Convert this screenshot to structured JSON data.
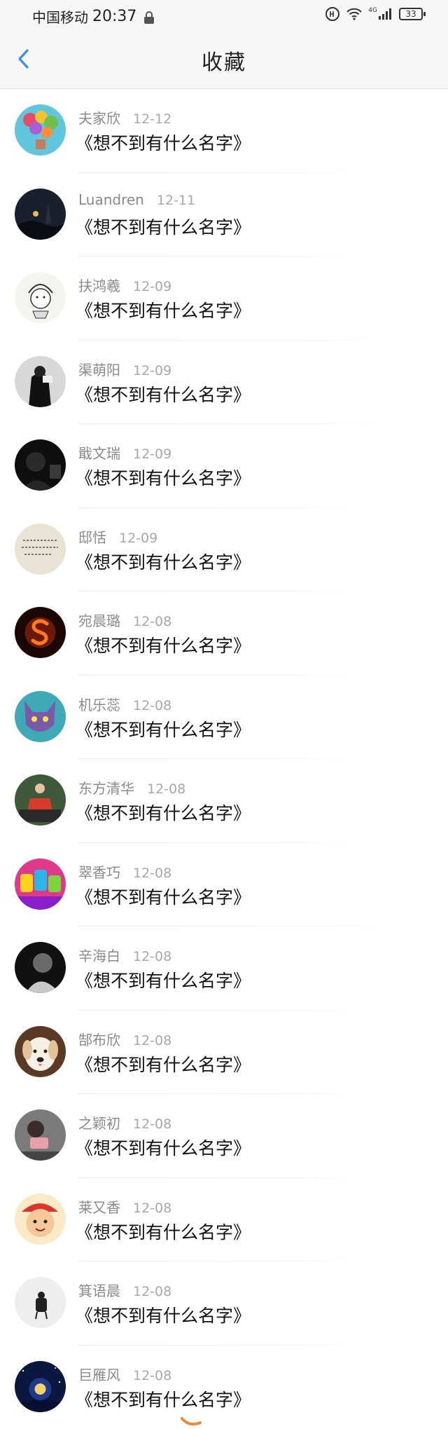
{
  "status_bar": {
    "carrier": "中国移动",
    "time": "20:37",
    "signal_label": "4G",
    "battery": "33"
  },
  "header": {
    "title": "收藏",
    "back_icon": "chevron-left-icon"
  },
  "items": [
    {
      "user": "夫家欣",
      "date": "12-12",
      "title": "《想不到有什么名字》"
    },
    {
      "user": "Luandren",
      "date": "12-11",
      "title": "《想不到有什么名字》"
    },
    {
      "user": "扶鸿羲",
      "date": "12-09",
      "title": "《想不到有什么名字》"
    },
    {
      "user": "渠萌阳",
      "date": "12-09",
      "title": "《想不到有什么名字》"
    },
    {
      "user": "戢文瑞",
      "date": "12-09",
      "title": "《想不到有什么名字》"
    },
    {
      "user": "邸恬",
      "date": "12-09",
      "title": "《想不到有什么名字》"
    },
    {
      "user": "宛晨璐",
      "date": "12-08",
      "title": "《想不到有什么名字》"
    },
    {
      "user": "机乐蕊",
      "date": "12-08",
      "title": "《想不到有什么名字》"
    },
    {
      "user": "东方清华",
      "date": "12-08",
      "title": "《想不到有什么名字》"
    },
    {
      "user": "翠香巧",
      "date": "12-08",
      "title": "《想不到有什么名字》"
    },
    {
      "user": "辛海白",
      "date": "12-08",
      "title": "《想不到有什么名字》"
    },
    {
      "user": "郜布欣",
      "date": "12-08",
      "title": "《想不到有什么名字》"
    },
    {
      "user": "之颖初",
      "date": "12-08",
      "title": "《想不到有什么名字》"
    },
    {
      "user": "莱又香",
      "date": "12-08",
      "title": "《想不到有什么名字》"
    },
    {
      "user": "箕语晨",
      "date": "12-08",
      "title": "《想不到有什么名字》"
    },
    {
      "user": "巨雁风",
      "date": "12-08",
      "title": "《想不到有什么名字》"
    }
  ],
  "colors": {
    "accent": "#3a8ee6",
    "username": "#8a8a8a",
    "date": "#a8a8a8",
    "title_text": "#111111",
    "bar_background": "#f7f7f7"
  }
}
